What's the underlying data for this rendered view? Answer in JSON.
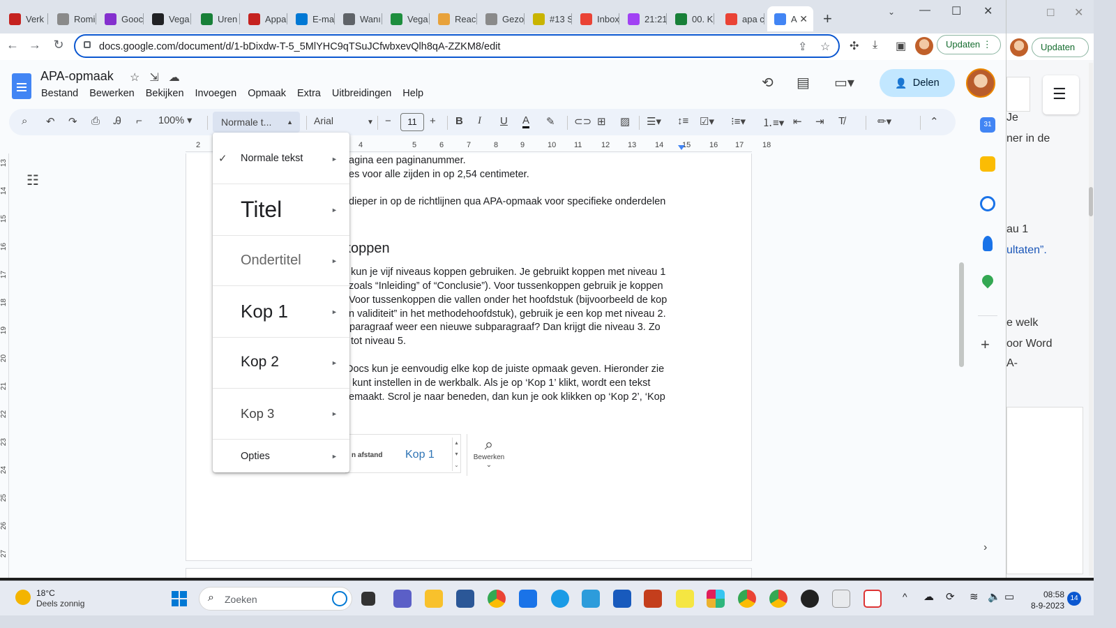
{
  "browser": {
    "tabs": [
      {
        "label": "Verk",
        "color": "#c5221f"
      },
      {
        "label": "Romi",
        "color": "#8a8a8a"
      },
      {
        "label": "Gooc",
        "color": "#8430ce"
      },
      {
        "label": "Vega",
        "color": "#202124"
      },
      {
        "label": "Uren",
        "color": "#188038"
      },
      {
        "label": "Appa",
        "color": "#c5221f"
      },
      {
        "label": "E-ma",
        "color": "#0078d4"
      },
      {
        "label": "Wanı",
        "color": "#5f6368"
      },
      {
        "label": "Vega",
        "color": "#1e8e3e"
      },
      {
        "label": "Reac",
        "color": "#e8a23b"
      },
      {
        "label": "Gezo",
        "color": "#8a8a8a"
      },
      {
        "label": "#13 S",
        "color": "#c9b400"
      },
      {
        "label": "Inbox",
        "color": "#ea4335"
      },
      {
        "label": "21:21",
        "color": "#a142f4"
      },
      {
        "label": "00. K",
        "color": "#188038"
      },
      {
        "label": "apa c",
        "color": "#ea4335"
      },
      {
        "label": "A",
        "color": "#4285f4"
      }
    ],
    "url": "docs.google.com/document/d/1-bDixdw-T-5_5MlYHC9qTSuJCfwbxevQlh8qA-ZZKM8/edit",
    "update_label": "Updaten",
    "update_label_2": "Updaten"
  },
  "docs": {
    "title": "APA-opmaak",
    "menu": [
      "Bestand",
      "Bewerken",
      "Bekijken",
      "Invoegen",
      "Opmaak",
      "Extra",
      "Uitbreidingen",
      "Help"
    ],
    "share_label": "Delen",
    "zoom": "100%",
    "style_value": "Normale t...",
    "font_value": "Arial",
    "font_size": "11"
  },
  "ruler": {
    "numbers": [
      "2",
      "4",
      "5",
      "6",
      "7",
      "8",
      "9",
      "10",
      "11",
      "12",
      "13",
      "14",
      "15",
      "16",
      "17",
      "18"
    ],
    "vnumbers": [
      "13",
      "14",
      "15",
      "16",
      "17",
      "18",
      "19",
      "20",
      "21",
      "22",
      "23",
      "24",
      "25",
      "26",
      "27"
    ]
  },
  "page": {
    "lines": [
      "agina een paginanummer.",
      "es voor alle zijden in op 2,54 centimeter.",
      "dieper in op de richtlijnen qua APA-opmaak voor specifieke onderdelen",
      "kun je vijf niveaus koppen gebruiken. Je gebruikt koppen met niveau 1",
      "zoals “Inleiding” of “Conclusie”). Voor tussenkoppen gebruik je koppen",
      "Voor tussenkoppen die vallen onder het hoofdstuk (bijvoorbeeld de kop",
      "n validiteit” in het methodehoofdstuk), gebruik je een kop met niveau 2.",
      "paragraaf weer een nieuwe subparagraaf? Dan krijgt die niveau 3. Zo",
      "tot niveau 5.",
      "Docs kun je eenvoudig elke kop de juiste opmaak geven. Hieronder zie",
      "kunt instellen in de werkbalk. Als je op ‘Kop 1’ klikt, wordt een tekst",
      "emaakt. Scrol je naar beneden, dan kun je ook klikken op ‘Kop 2’, ‘Kop"
    ],
    "heading": "koppen",
    "word_image": {
      "afstand": "n afstand",
      "kop1": "Kop 1",
      "bewerken": "Bewerken"
    }
  },
  "style_menu": {
    "items": [
      {
        "label": "Normale tekst",
        "checked": true
      },
      {
        "label": "Titel"
      },
      {
        "label": "Ondertitel"
      },
      {
        "label": "Kop 1"
      },
      {
        "label": "Kop 2"
      },
      {
        "label": "Kop 3"
      },
      {
        "label": "Opties"
      }
    ]
  },
  "bg_window": {
    "snippets": [
      "Je",
      "ner in de",
      "au 1",
      "ultaten”.",
      "e welk",
      "oor Word",
      "A-"
    ]
  },
  "taskbar": {
    "weather_temp": "18°C",
    "weather_desc": "Deels zonnig",
    "search_placeholder": "Zoeken",
    "time": "08:58",
    "date": "8-9-2023",
    "notif_count": "14"
  }
}
